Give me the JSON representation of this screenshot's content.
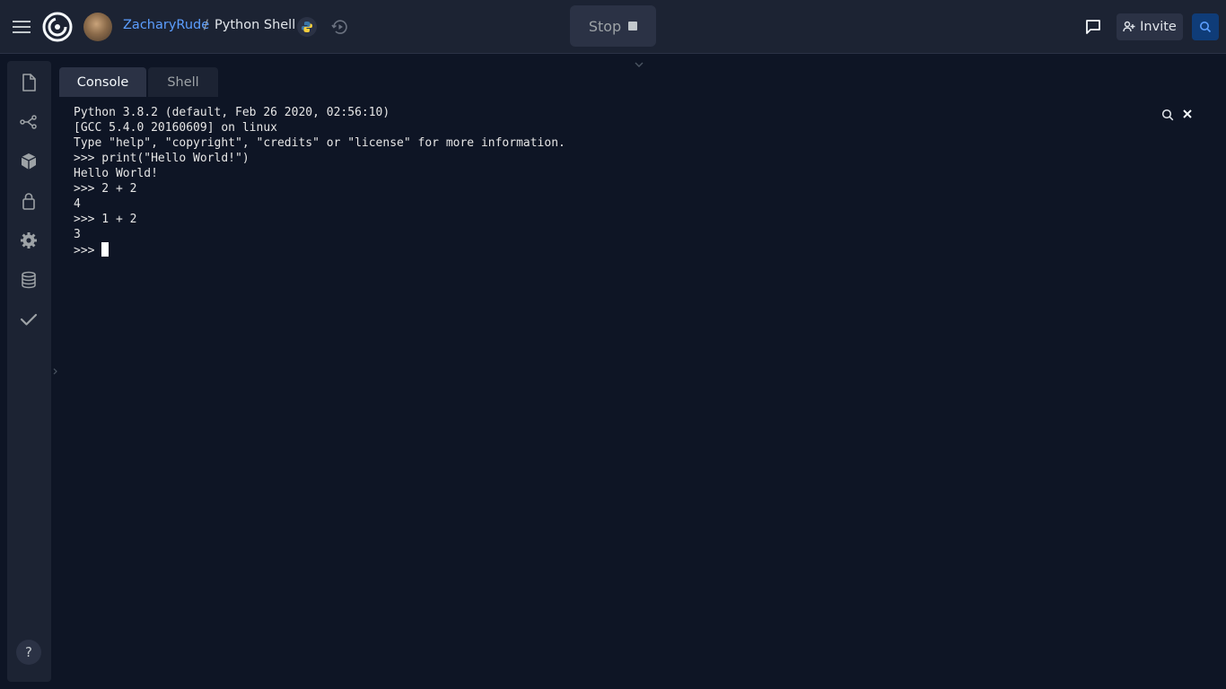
{
  "topbar": {
    "user": "ZacharyRude",
    "separator": "/",
    "repl_name": "Python Shell",
    "stop_label": "Stop",
    "invite_label": "Invite"
  },
  "tabs": [
    {
      "label": "Console",
      "active": true
    },
    {
      "label": "Shell",
      "active": false
    }
  ],
  "sidebar": {
    "icons": [
      "files-icon",
      "version-control-icon",
      "packages-icon",
      "secrets-icon",
      "settings-icon",
      "database-icon",
      "unit-tests-icon"
    ],
    "help_label": "?"
  },
  "console": {
    "lines": [
      "Python 3.8.2 (default, Feb 26 2020, 02:56:10)",
      "[GCC 5.4.0 20160609] on linux",
      "Type \"help\", \"copyright\", \"credits\" or \"license\" for more information.",
      ">>> print(\"Hello World!\")",
      "Hello World!",
      ">>> 2 + 2",
      "4",
      ">>> 1 + 2",
      "3"
    ],
    "prompt": ">>> "
  },
  "colors": {
    "background": "#0e1525",
    "panel": "#1c2333",
    "accent": "#5c9eff"
  }
}
